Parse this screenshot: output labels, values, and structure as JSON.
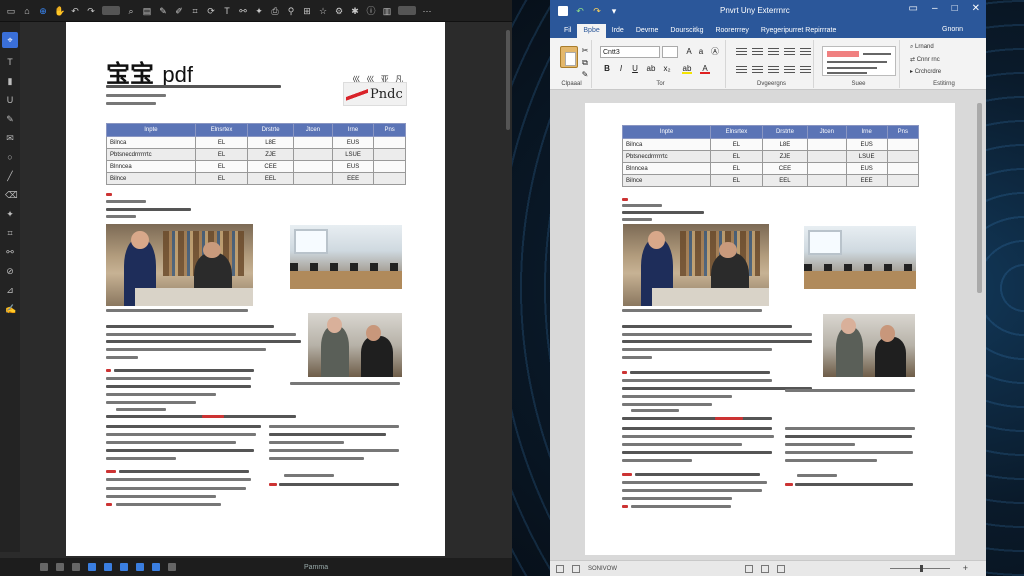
{
  "pdf": {
    "title_cjk": "宝宝",
    "title_en": "pdf",
    "corner_text": "巛 巛 亚 凡",
    "logo_text": "Pndc",
    "status_label": "Pamma"
  },
  "word": {
    "title": "Pnvrt Uny Exterrnrc",
    "tabs": [
      "Fil",
      "Bpbe",
      "Irde",
      "Devrne",
      "Dourscitkg",
      "Roorerrrey",
      "Ryegeripurret Repirrrate"
    ],
    "tab_right": "Gnonn",
    "font_name": "Cntt3",
    "ribbon_labels": [
      "Clpaaal",
      "Tor",
      "Dvgeergns",
      "Suee",
      "Estitirng"
    ],
    "edit_items": [
      "Lrnand",
      "Cnnr rnc",
      "Crchcrdre"
    ],
    "status_text": "SONIVOW"
  },
  "table": {
    "headers": [
      "Inpte",
      "Elnsrtex",
      "Drstrte",
      "Jtcen",
      "Irne",
      "Pns"
    ],
    "rows": [
      [
        "Bilnca",
        "EL",
        "L8E",
        "",
        "EUS",
        ""
      ],
      [
        "Pbtsnecdrrrrrrtc",
        "EL",
        "ZJE",
        "",
        "LSUE",
        ""
      ],
      [
        "Blnncea",
        "EL",
        "CEE",
        "",
        "EUS",
        ""
      ],
      [
        "Bilnce",
        "EL",
        "EEL",
        "",
        "EEE",
        ""
      ]
    ]
  },
  "colors": {
    "word_blue": "#2b579a",
    "table_header": "#5b74b6",
    "accent_red": "#d9232a",
    "pdf_active": "#3a6fd8"
  },
  "icons": {
    "pdf_toolbar": [
      "home-icon",
      "select-icon",
      "zoom-icon",
      "pages-icon",
      "comment-icon",
      "draw-icon",
      "share-icon"
    ],
    "pdf_side": [
      "select-tool-icon",
      "text-tool-icon",
      "highlight-icon",
      "underline-icon",
      "comment-icon",
      "pen-icon",
      "shape-icon",
      "stamp-icon",
      "eraser-icon",
      "sign-icon"
    ]
  }
}
